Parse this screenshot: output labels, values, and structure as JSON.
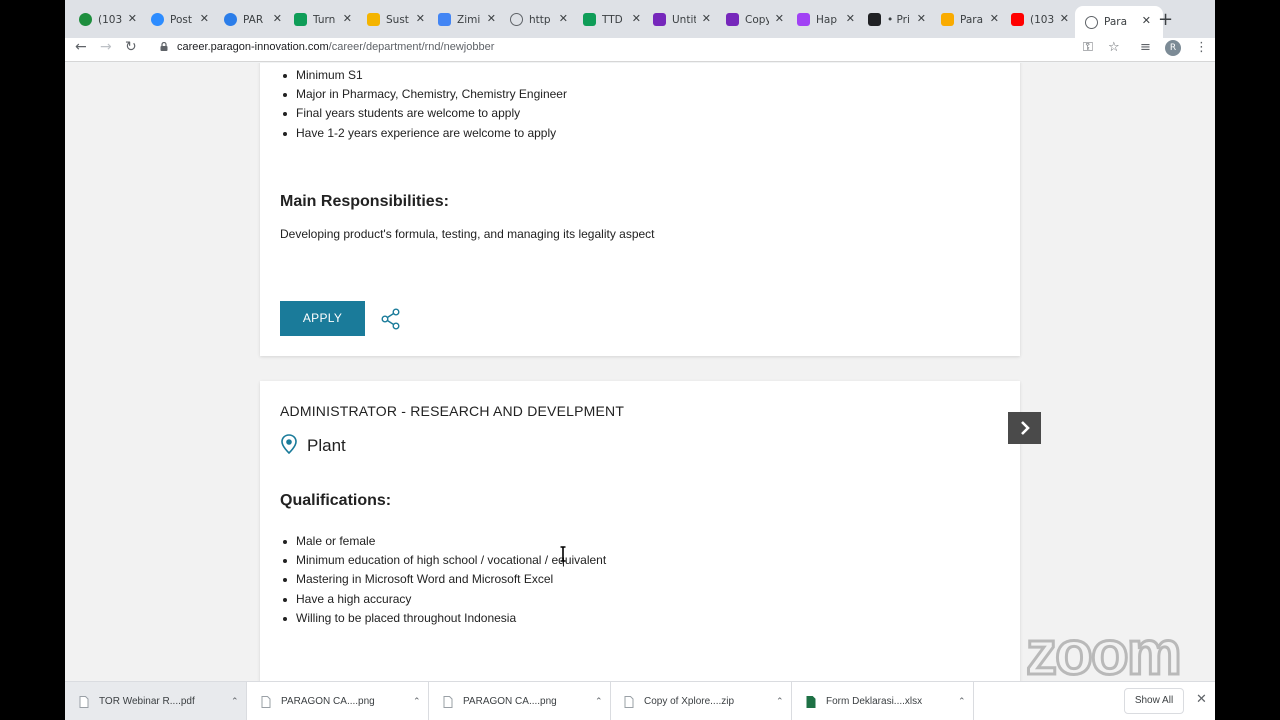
{
  "tabs": [
    {
      "title": "(103",
      "icon": "sheets-green-icon",
      "color": "#1e8e3e"
    },
    {
      "title": "Post",
      "icon": "zoom-icon",
      "color": "#2d8cff"
    },
    {
      "title": "PAR",
      "icon": "canva-icon",
      "color": "#2b7de9"
    },
    {
      "title": "Turn",
      "icon": "sheets-icon",
      "color": "#0f9d58"
    },
    {
      "title": "Sust",
      "icon": "slides-icon",
      "color": "#f4b400"
    },
    {
      "title": "Zimi",
      "icon": "translate-icon",
      "color": "#4285f4"
    },
    {
      "title": "http",
      "icon": "globe-icon",
      "color": "#5f6368"
    },
    {
      "title": "TTD",
      "icon": "sheets-icon",
      "color": "#0f9d58"
    },
    {
      "title": "Untit",
      "icon": "forms-icon",
      "color": "#7627bb"
    },
    {
      "title": "Copy",
      "icon": "forms-icon",
      "color": "#7627bb"
    },
    {
      "title": "Hap",
      "icon": "app-icon",
      "color": "#a142f4"
    },
    {
      "title": "• Pri",
      "icon": "notion-icon",
      "color": "#202124"
    },
    {
      "title": "Para",
      "icon": "pen-icon",
      "color": "#f9ab00"
    },
    {
      "title": "(103",
      "icon": "youtube-icon",
      "color": "#ff0000"
    },
    {
      "title": "Para",
      "icon": "globe-icon",
      "color": "#5f6368",
      "active": true
    }
  ],
  "toolbar": {
    "url_domain": "career.paragon-innovation.com",
    "url_path": "/career/department/rnd/newjobber",
    "profile_initial": "R"
  },
  "job1": {
    "qualifications": [
      "Minimum S1",
      "Major in Pharmacy, Chemistry, Chemistry Engineer",
      "Final years students are welcome to apply",
      "Have 1-2 years experience are welcome to apply"
    ],
    "responsibilities_heading": "Main Responsibilities:",
    "responsibilities_text": "Developing product's formula, testing, and managing its legality aspect",
    "apply_label": "APPLY"
  },
  "job2": {
    "title": "ADMINISTRATOR - RESEARCH AND DEVELPMENT",
    "location": "Plant",
    "qualifications_heading": "Qualifications:",
    "qualifications": [
      "Male or female",
      "Minimum education of high school / vocational / equivalent",
      "Mastering in Microsoft Word and Microsoft Excel",
      "Have a high accuracy",
      "Willing to be placed throughout Indonesia"
    ]
  },
  "downloads": [
    {
      "name": "TOR Webinar R....pdf",
      "icon": "pdf-file-icon"
    },
    {
      "name": "PARAGON CA....png",
      "icon": "image-file-icon"
    },
    {
      "name": "PARAGON CA....png",
      "icon": "image-file-icon"
    },
    {
      "name": "Copy of Xplore....zip",
      "icon": "zip-file-icon"
    },
    {
      "name": "Form Deklarasi....xlsx",
      "icon": "excel-file-icon"
    }
  ],
  "show_all_label": "Show All",
  "watermark": "zoom",
  "colors": {
    "accent": "#1a7b9a",
    "page_bg": "#f2f2f2"
  }
}
